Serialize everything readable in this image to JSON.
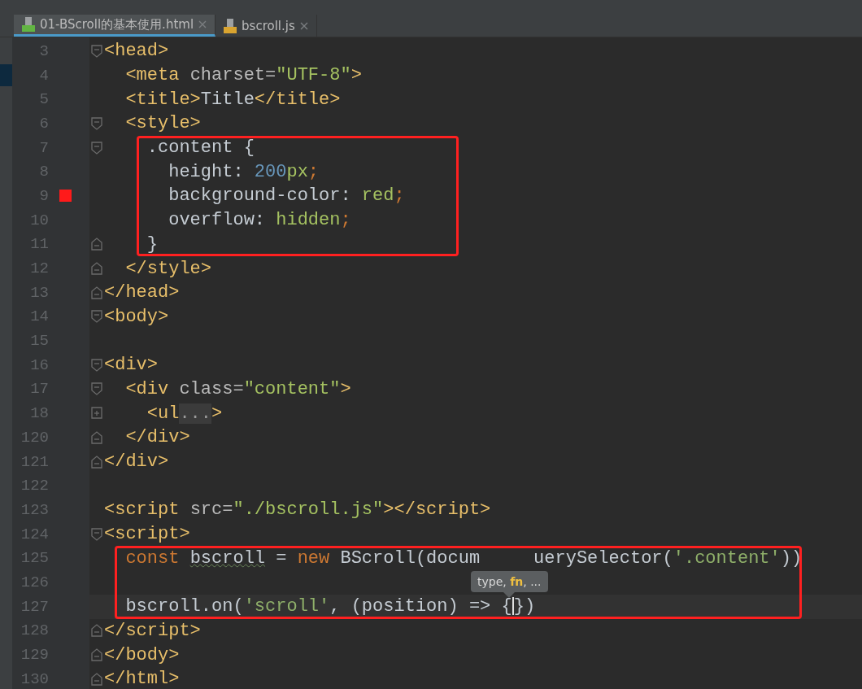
{
  "tabs": [
    {
      "label": "01-BScroll的基本使用.html",
      "kind": "html",
      "selected": true
    },
    {
      "label": "bscroll.js",
      "kind": "js",
      "selected": false
    }
  ],
  "tooltip": {
    "text": "type, **fn**, ..."
  },
  "lines": [
    {
      "number": "3",
      "fold_open": true,
      "tokens": [
        {
          "kind": "tag",
          "text": "<head>"
        }
      ]
    },
    {
      "number": "4",
      "tokens": [
        {
          "kind": "tag",
          "text": "  <meta "
        },
        {
          "kind": "attr",
          "text": "charset="
        },
        {
          "kind": "string",
          "text": "\"UTF-8\""
        },
        {
          "kind": "tag",
          "text": ">"
        }
      ]
    },
    {
      "number": "5",
      "tokens": [
        {
          "kind": "tag",
          "text": "  <title>"
        },
        {
          "kind": "plain",
          "text": "Title"
        },
        {
          "kind": "tag",
          "text": "</title>"
        }
      ]
    },
    {
      "number": "6",
      "fold_open": true,
      "tokens": [
        {
          "kind": "tag",
          "text": "  <style>"
        }
      ]
    },
    {
      "number": "7",
      "fold_open": true,
      "boxed": true,
      "tokens": [
        {
          "kind": "plain",
          "text": "    .content {"
        }
      ]
    },
    {
      "number": "8",
      "boxed": true,
      "tokens": [
        {
          "kind": "plain",
          "text": "      height: "
        },
        {
          "kind": "number",
          "text": "200"
        },
        {
          "kind": "string",
          "text": "px"
        },
        {
          "kind": "keyword",
          "text": ";"
        }
      ]
    },
    {
      "number": "9",
      "boxed": true,
      "breakpoint": true,
      "tokens": [
        {
          "kind": "plain",
          "text": "      background-color: "
        },
        {
          "kind": "string",
          "text": "red"
        },
        {
          "kind": "keyword",
          "text": ";"
        }
      ]
    },
    {
      "number": "10",
      "boxed": true,
      "tokens": [
        {
          "kind": "plain",
          "text": "      overflow: "
        },
        {
          "kind": "string",
          "text": "hidden"
        },
        {
          "kind": "keyword",
          "text": ";"
        }
      ]
    },
    {
      "number": "11",
      "fold_close": true,
      "boxed": true,
      "tokens": [
        {
          "kind": "plain",
          "text": "    }"
        }
      ]
    },
    {
      "number": "12",
      "fold_close": true,
      "tokens": [
        {
          "kind": "tag",
          "text": "  </style>"
        }
      ]
    },
    {
      "number": "13",
      "fold_close": true,
      "tokens": [
        {
          "kind": "tag",
          "text": "</head>"
        }
      ]
    },
    {
      "number": "14",
      "fold_open": true,
      "tokens": [
        {
          "kind": "tag",
          "text": "<body>"
        }
      ]
    },
    {
      "number": "15"
    },
    {
      "number": "16",
      "fold_open": true,
      "tokens": [
        {
          "kind": "tag",
          "text": "<div>"
        }
      ]
    },
    {
      "number": "17",
      "fold_open": true,
      "tokens": [
        {
          "kind": "tag",
          "text": "  <div "
        },
        {
          "kind": "attr",
          "text": "class="
        },
        {
          "kind": "string",
          "text": "\"content\""
        },
        {
          "kind": "tag",
          "text": ">"
        }
      ]
    },
    {
      "number": "18",
      "collapsed": true,
      "tokens": [
        {
          "kind": "tag",
          "text": "    <ul"
        },
        {
          "kind": "folded",
          "text": "..."
        },
        {
          "kind": "tag",
          "text": ">"
        }
      ]
    },
    {
      "number": "120",
      "fold_close": true,
      "tokens": [
        {
          "kind": "tag",
          "text": "  </div>"
        }
      ]
    },
    {
      "number": "121",
      "fold_close": true,
      "tokens": [
        {
          "kind": "tag",
          "text": "</div>"
        }
      ]
    },
    {
      "number": "122"
    },
    {
      "number": "123",
      "tokens": [
        {
          "kind": "tag",
          "text": "<script "
        },
        {
          "kind": "attr",
          "text": "src="
        },
        {
          "kind": "string",
          "text": "\"./bscroll.js\""
        },
        {
          "kind": "tag",
          "text": "></script>"
        }
      ]
    },
    {
      "number": "124",
      "fold_open": true,
      "tokens": [
        {
          "kind": "tag",
          "text": "<script>"
        }
      ]
    },
    {
      "number": "125",
      "boxed": true,
      "tokens": [
        {
          "kind": "keyword",
          "text": "  const "
        },
        {
          "kind": "warning",
          "text": "bscroll"
        },
        {
          "kind": "plain",
          "text": " = "
        },
        {
          "kind": "keyword",
          "text": "new "
        },
        {
          "kind": "plain",
          "text": "BScroll(docum",
          "covered_after": true
        },
        {
          "kind": "plain",
          "text": "uerySelector("
        },
        {
          "kind": "js_string",
          "text": "'.content'"
        },
        {
          "kind": "plain",
          "text": "))"
        }
      ]
    },
    {
      "number": "126",
      "boxed": true,
      "tooltip_here": true
    },
    {
      "number": "127",
      "boxed": true,
      "current": true,
      "tokens": [
        {
          "kind": "plain",
          "text": "  bscroll.on("
        },
        {
          "kind": "js_string",
          "text": "'scroll'"
        },
        {
          "kind": "plain",
          "text": ", (position) => {",
          "caret_after": true
        },
        {
          "kind": "plain",
          "text": "})"
        }
      ]
    },
    {
      "number": "128",
      "fold_close": true,
      "tokens": [
        {
          "kind": "tag",
          "text": "</script>"
        }
      ]
    },
    {
      "number": "129",
      "fold_close": true,
      "tokens": [
        {
          "kind": "tag",
          "text": "</body>"
        }
      ]
    },
    {
      "number": "130",
      "fold_close": true,
      "tokens": [
        {
          "kind": "tag",
          "text": "</html>"
        }
      ]
    }
  ]
}
